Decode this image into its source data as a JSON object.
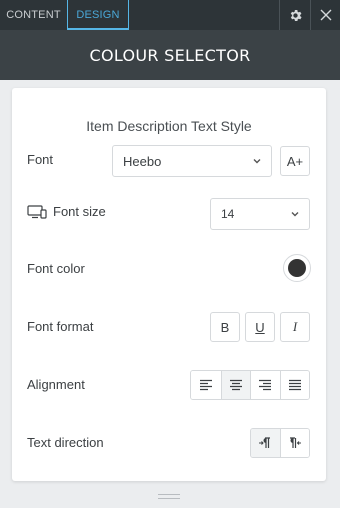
{
  "tabs": {
    "content": "CONTENT",
    "design": "DESIGN"
  },
  "header": {
    "title": "COLOUR SELECTOR"
  },
  "icons": {
    "settings": "gear-icon",
    "close": "close-icon",
    "desktop": "desktop-mobile-icon",
    "font_add": "font-add-icon"
  },
  "section": {
    "title": "Item Description Text Style"
  },
  "font": {
    "label": "Font",
    "value": "Heebo",
    "add_button": "A+"
  },
  "font_size": {
    "label": "Font size",
    "value": "14"
  },
  "font_color": {
    "label": "Font color",
    "color": "#333333"
  },
  "font_format": {
    "label": "Font format",
    "bold": "B",
    "underline": "U",
    "italic": "I"
  },
  "alignment": {
    "label": "Alignment",
    "options": [
      "left",
      "center",
      "right",
      "justify"
    ],
    "selected": "center"
  },
  "text_direction": {
    "label": "Text direction",
    "options": [
      "ltr",
      "rtl"
    ],
    "selected": "ltr"
  },
  "colors": {
    "accent": "#56b6e6",
    "topbar": "#2d3438",
    "header": "#3b4246"
  }
}
